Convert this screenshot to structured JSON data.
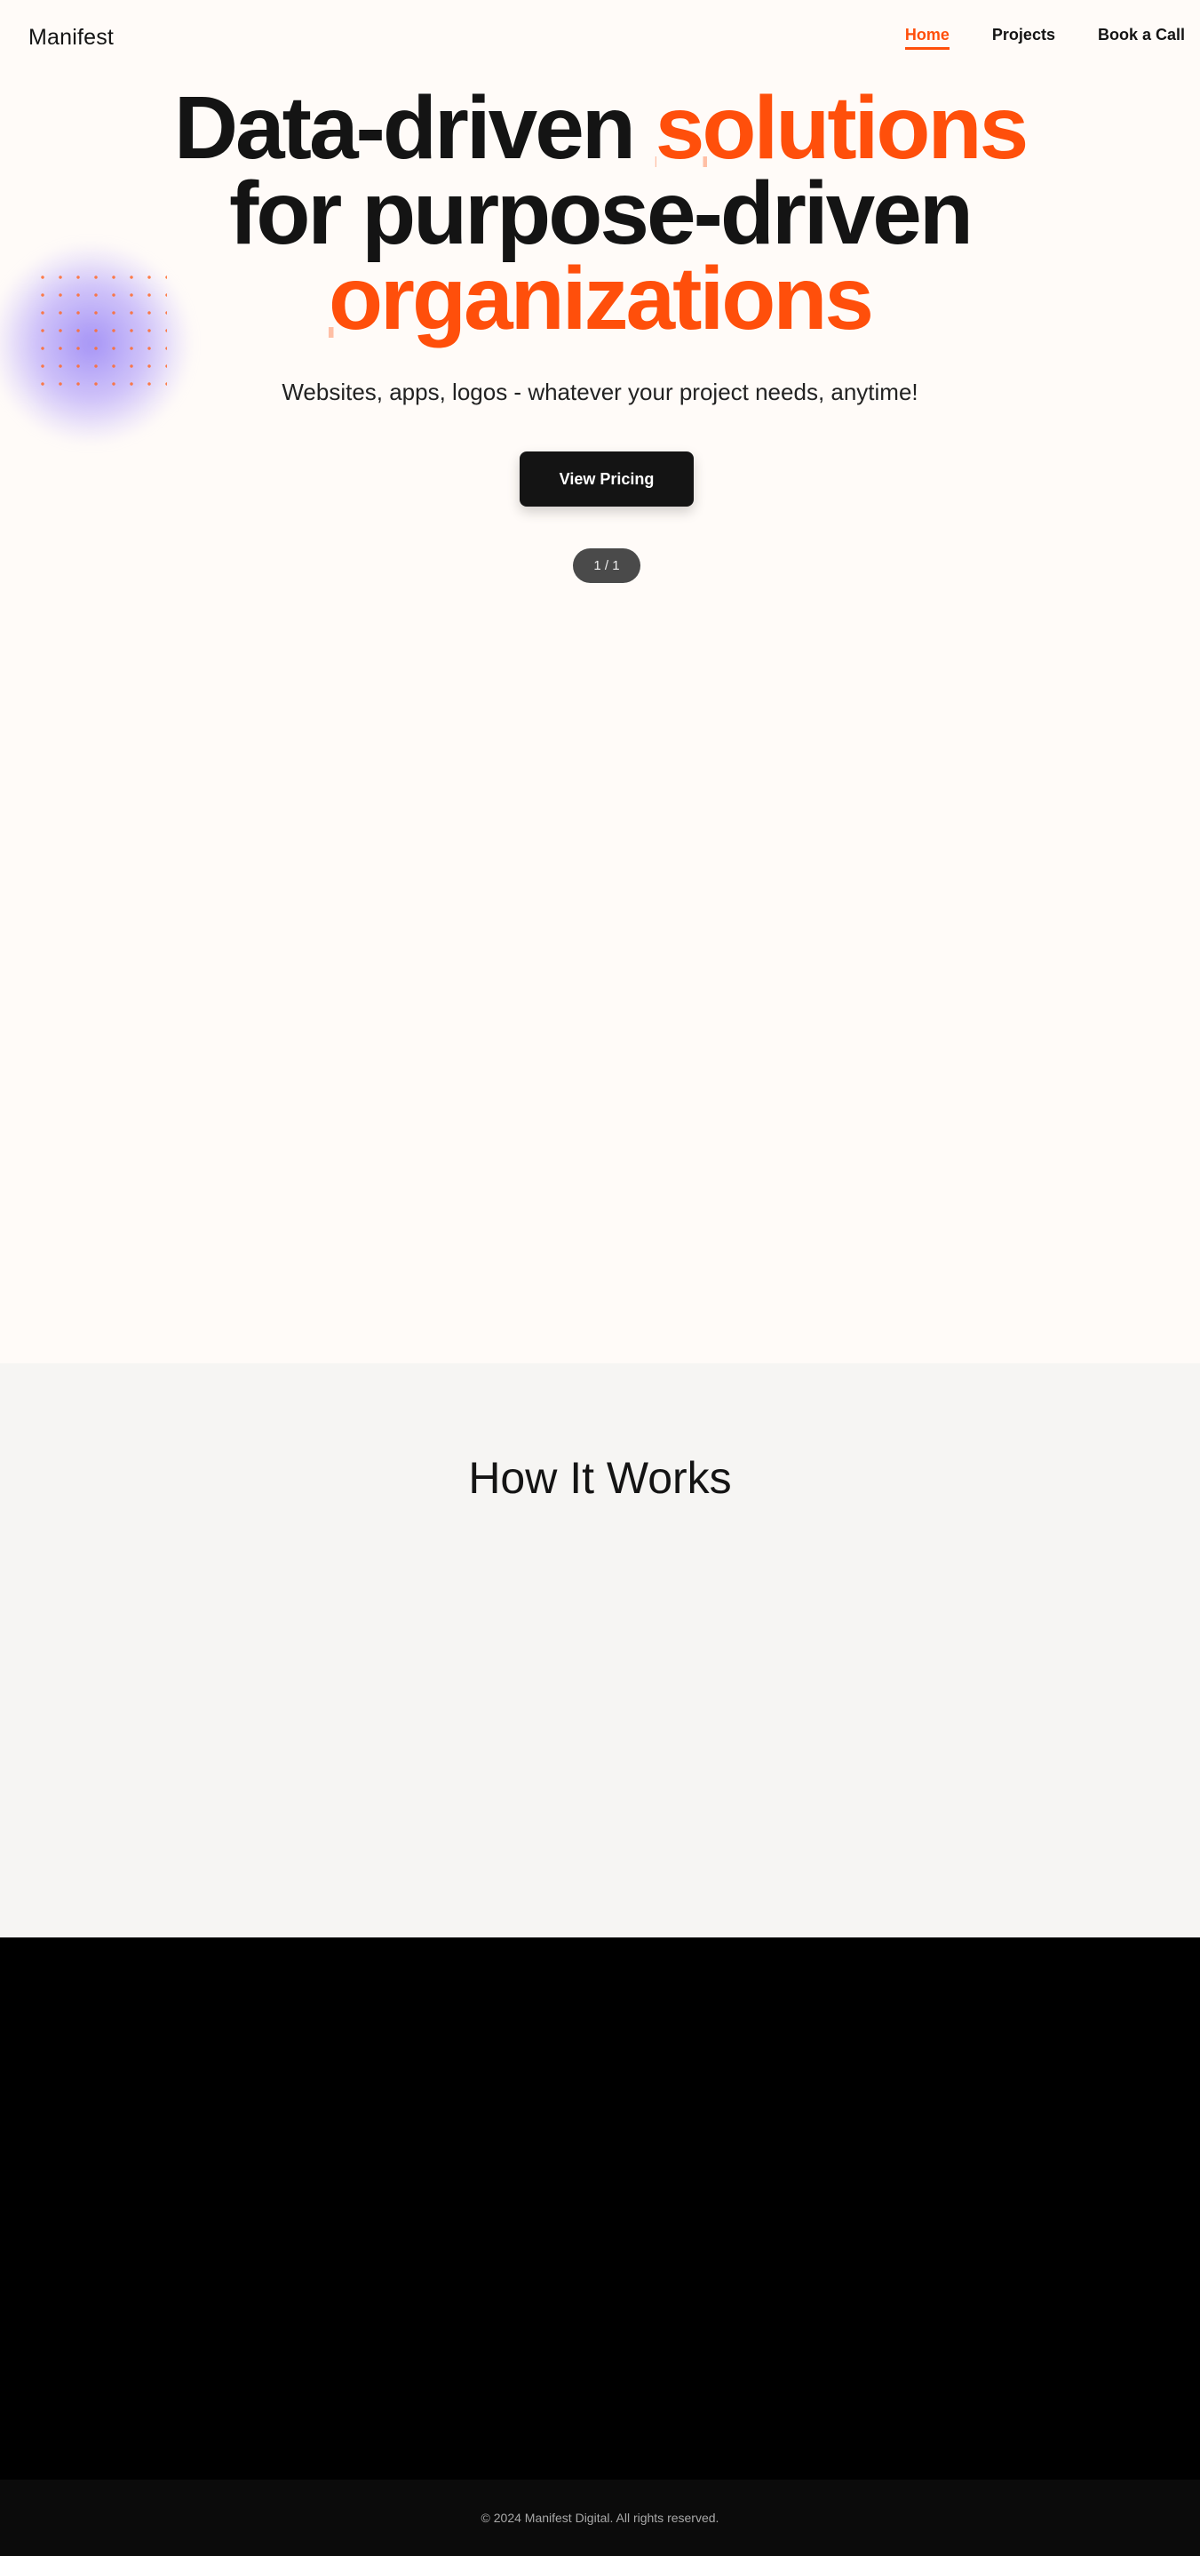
{
  "header": {
    "logo": "Manifest",
    "nav": [
      {
        "label": "Home",
        "active": true
      },
      {
        "label": "Projects",
        "active": false
      },
      {
        "label": "Book a Call",
        "active": false
      }
    ]
  },
  "hero": {
    "headline": {
      "part1": "Data-driven ",
      "accent1": "solutions",
      "part2": "for purpose-driven",
      "accent2": "organizations"
    },
    "subtitle": "Websites, apps, logos - whatever your project needs, anytime!",
    "cta_label": "View Pricing",
    "pager": "1 / 1"
  },
  "how_it_works": {
    "title": "How It Works"
  },
  "footer": {
    "copyright": "© 2024 Manifest Digital. All rights reserved."
  },
  "colors": {
    "accent": "#ff4f0b",
    "text": "#141414",
    "background": "#fffbf8",
    "section_bg": "#f6f5f3",
    "dark_bg": "#000000"
  }
}
